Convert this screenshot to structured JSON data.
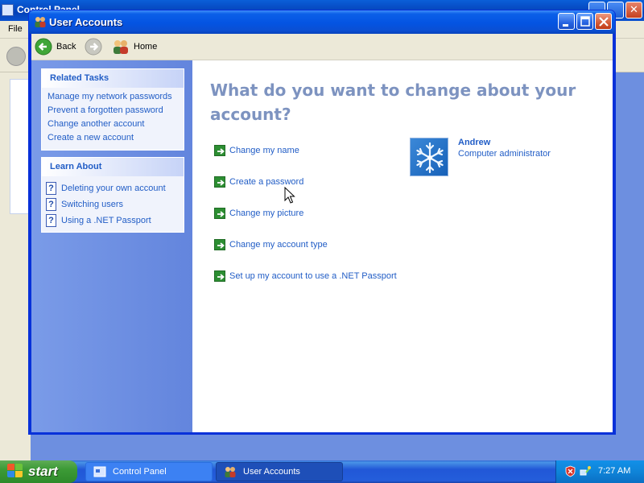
{
  "background_window": {
    "title": "Control Panel",
    "menu_file": "File"
  },
  "window": {
    "title": "User Accounts",
    "controls": {
      "minimize": "minimize-icon",
      "maximize": "maximize-icon",
      "close": "close-icon"
    }
  },
  "toolbar": {
    "back_label": "Back",
    "forward_icon": "forward-arrow-icon",
    "home_label": "Home"
  },
  "sidebar": {
    "related_tasks": {
      "title": "Related Tasks",
      "items": [
        "Manage my network passwords",
        "Prevent a forgotten password",
        "Change another account",
        "Create a new account"
      ]
    },
    "learn_about": {
      "title": "Learn About",
      "items": [
        "Deleting your own account",
        "Switching users",
        "Using a .NET Passport"
      ]
    }
  },
  "main": {
    "heading": "What do you want to change about your account?",
    "options": [
      "Change my name",
      "Create a password",
      "Change my picture",
      "Change my account type",
      "Set up my account to use a .NET Passport"
    ]
  },
  "user": {
    "name": "Andrew",
    "role": "Computer administrator",
    "picture": "snowflake-picture"
  },
  "taskbar": {
    "start_label": "start",
    "tasks": [
      {
        "label": "Control Panel",
        "active": false
      },
      {
        "label": "User Accounts",
        "active": true
      }
    ],
    "clock": "7:27 AM"
  },
  "colors": {
    "link": "#215dc6",
    "heading": "#7d93c0",
    "titlebar": "#0454e2",
    "sidebar": "#6d8fe0",
    "arrow_green": "#2c8e32"
  }
}
